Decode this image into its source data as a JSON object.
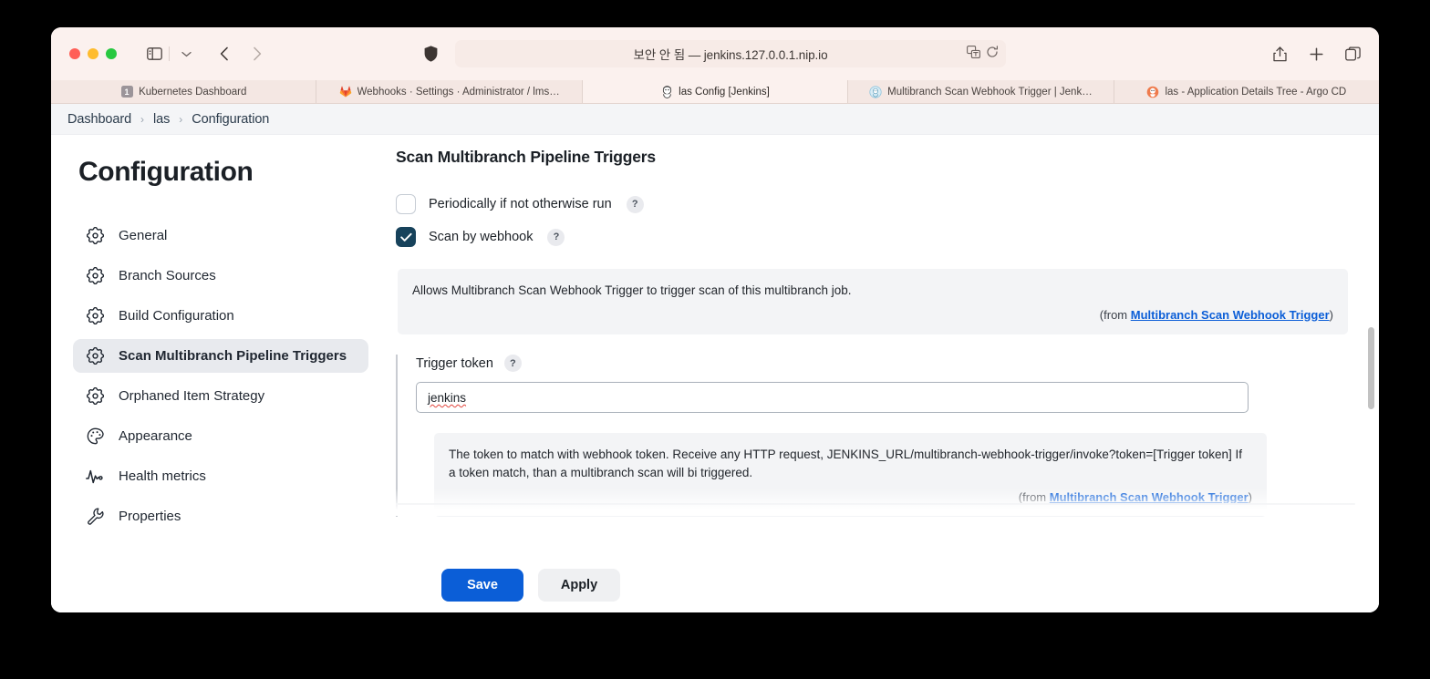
{
  "browser": {
    "traffic_lights": [
      "close",
      "minimize",
      "zoom"
    ],
    "url": "보안 안 됨 — jenkins.127.0.0.1.nip.io",
    "toolbar_icons": [
      "sidebar-icon",
      "chevron-down-icon",
      "back-icon",
      "forward-icon",
      "shield-icon",
      "translate-icon",
      "reload-icon",
      "share-icon",
      "new-tab-icon",
      "tab-overview-icon"
    ],
    "tabs": [
      {
        "label": "Kubernetes Dashboard",
        "favicon": "k8s-badge-icon",
        "badge": "1",
        "active": false
      },
      {
        "label": "Webhooks · Settings · Administrator / lms…",
        "favicon": "gitlab-icon",
        "active": false
      },
      {
        "label": "las Config [Jenkins]",
        "favicon": "jenkins-icon",
        "active": true
      },
      {
        "label": "Multibranch Scan Webhook Trigger | Jenk…",
        "favicon": "jenkins-plugin-icon",
        "active": false
      },
      {
        "label": "las - Application Details Tree - Argo CD",
        "favicon": "argocd-icon",
        "active": false
      }
    ]
  },
  "breadcrumb": {
    "items": [
      "Dashboard",
      "las",
      "Configuration"
    ],
    "separator": "›"
  },
  "sidebar": {
    "title": "Configuration",
    "items": [
      {
        "label": "General",
        "icon": "gear-icon",
        "active": false
      },
      {
        "label": "Branch Sources",
        "icon": "gear-icon",
        "active": false
      },
      {
        "label": "Build Configuration",
        "icon": "gear-icon",
        "active": false
      },
      {
        "label": "Scan Multibranch Pipeline Triggers",
        "icon": "gear-icon",
        "active": true
      },
      {
        "label": "Orphaned Item Strategy",
        "icon": "gear-icon",
        "active": false
      },
      {
        "label": "Appearance",
        "icon": "palette-icon",
        "active": false
      },
      {
        "label": "Health metrics",
        "icon": "pulse-icon",
        "active": false
      },
      {
        "label": "Properties",
        "icon": "wrench-icon",
        "active": false
      }
    ]
  },
  "main": {
    "heading": "Scan Multibranch Pipeline Triggers",
    "checkbox_periodic": {
      "label": "Periodically if not otherwise run",
      "checked": false,
      "help": "?"
    },
    "checkbox_webhook": {
      "label": "Scan by webhook",
      "checked": true,
      "help": "?"
    },
    "webhook_note": {
      "text": "Allows Multibranch Scan Webhook Trigger to trigger scan of this multibranch job.",
      "from_prefix": "(from ",
      "from_link": "Multibranch Scan Webhook Trigger",
      "from_suffix": ")"
    },
    "trigger_token": {
      "label": "Trigger token",
      "help": "?",
      "value": "jenkins",
      "placeholder": ""
    },
    "token_note": {
      "text": "The token to match with webhook token. Receive any HTTP request, JENKINS_URL/multibranch-webhook-trigger/invoke?token=[Trigger token] If a token match, than a multibranch scan will bi triggered.",
      "from_prefix": "(from ",
      "from_link": "Multibranch Scan Webhook Trigger",
      "from_suffix": ")"
    }
  },
  "actions": {
    "save_label": "Save",
    "apply_label": "Apply"
  },
  "colors": {
    "accent_blue": "#0b5ed7",
    "checkbox_checked": "#17425b",
    "link_blue": "#0b5ed7",
    "sidebar_active_bg": "#e8eaee",
    "chrome_bg": "#fbf1ee"
  }
}
